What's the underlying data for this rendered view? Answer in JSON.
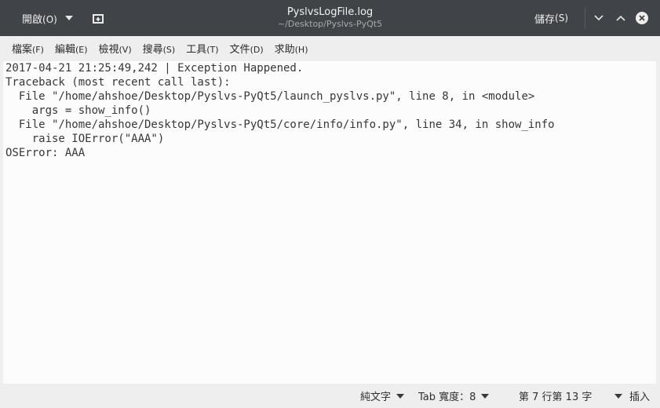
{
  "header": {
    "open_label": "開啟",
    "open_accel": "(O)",
    "title": "PyslvsLogFile.log",
    "subtitle": "~/Desktop/Pyslvs-PyQt5",
    "save_label": "儲存",
    "save_accel": "(S)"
  },
  "menu": {
    "items": [
      {
        "label": "檔案",
        "accel": "(F)"
      },
      {
        "label": "編輯",
        "accel": "(E)"
      },
      {
        "label": "檢視",
        "accel": "(V)"
      },
      {
        "label": "搜尋",
        "accel": "(S)"
      },
      {
        "label": "工具",
        "accel": "(T)"
      },
      {
        "label": "文件",
        "accel": "(D)"
      },
      {
        "label": "求助",
        "accel": "(H)"
      }
    ]
  },
  "editor": {
    "lines": [
      "2017-04-21 21:25:49,242 | Exception Happened.",
      "Traceback (most recent call last):",
      "  File \"/home/ahshoe/Desktop/Pyslvs-PyQt5/launch_pyslvs.py\", line 8, in <module>",
      "    args = show_info()",
      "  File \"/home/ahshoe/Desktop/Pyslvs-PyQt5/core/info/info.py\", line 34, in show_info",
      "    raise IOError(\"AAA\")",
      "OSError: AAA"
    ]
  },
  "status": {
    "syntax": "純文字",
    "tab_width": "Tab 寬度：8",
    "position": "第 7 行第 13 字",
    "insert_mode": "插入"
  },
  "icons": {
    "new_tab": "new-tab-icon",
    "minimize": "minimize-icon",
    "maximize": "maximize-icon",
    "close": "close-icon"
  },
  "colors": {
    "headerbar": "#404348",
    "editor_bg": "#fcfcfc",
    "window_bg": "#eeeeee"
  }
}
